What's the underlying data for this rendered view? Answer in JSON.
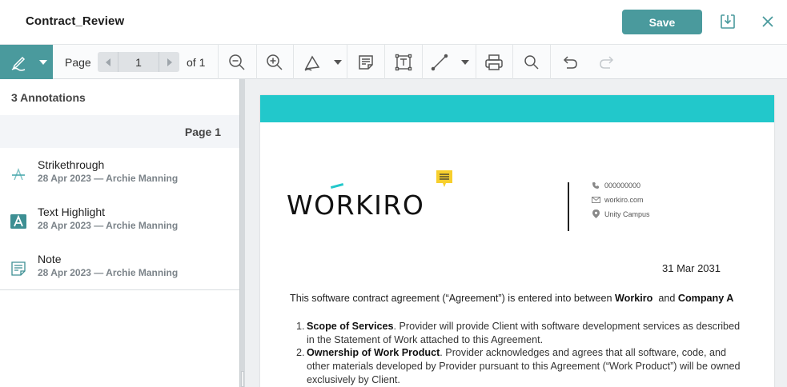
{
  "window": {
    "title": "Contract_Review",
    "save_label": "Save",
    "icons": {
      "download": "download-icon",
      "close": "close-icon"
    }
  },
  "toolbar": {
    "page_label": "Page",
    "page_value": "1",
    "page_of": "of 1",
    "icons": [
      "pen-annotation-icon",
      "chevron-down-icon",
      "chevron-left-icon",
      "chevron-right-icon",
      "zoom-out-icon",
      "zoom-in-icon",
      "shape-tool-icon",
      "chevron-down-icon",
      "sticky-note-icon",
      "text-box-icon",
      "line-tool-icon",
      "chevron-down-icon",
      "print-icon",
      "search-icon",
      "undo-icon",
      "redo-icon"
    ]
  },
  "panel": {
    "heading": "3 Annotations",
    "page_group": "Page 1",
    "annotations": [
      {
        "type": "Strikethrough",
        "meta": "28 Apr 2023 — Archie Manning",
        "icon": "strikethrough-icon"
      },
      {
        "type": "Text Highlight",
        "meta": "28 Apr 2023 — Archie Manning",
        "icon": "text-highlight-icon"
      },
      {
        "type": "Note",
        "meta": "28 Apr 2023 — Archie Manning",
        "icon": "note-icon"
      }
    ]
  },
  "document": {
    "logo_text": "WORKIRO",
    "contact": {
      "phone": "000000000",
      "web": "workiro.com",
      "address": "Unity Campus"
    },
    "date": "31 Mar 2031",
    "intro": {
      "text": "This software contract agreement (“Agreement”) is entered into between",
      "party1": "Workiro",
      "and": "and",
      "party2": "Company A"
    },
    "clauses": [
      {
        "num": "1.",
        "title": "Scope of Services",
        "text": ". Provider will provide Client with software development services as described in the Statement of Work attached to this Agreement."
      },
      {
        "num": "2.",
        "title": "Ownership of Work Product",
        "text": ". Provider acknowledges and agrees that all software, code, and other materials developed by Provider pursuant to this Agreement (“Work Product”) will be owned exclusively by Client."
      }
    ]
  },
  "colors": {
    "accent": "#4a9a9d",
    "band": "#22c8cb",
    "note": "#f7cf2d"
  }
}
